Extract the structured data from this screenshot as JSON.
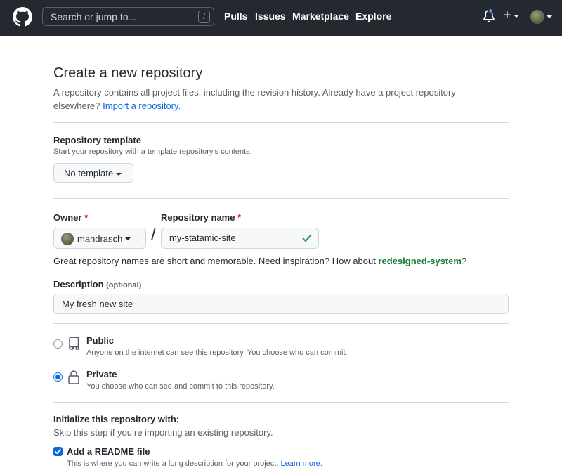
{
  "header": {
    "search_placeholder": "Search or jump to...",
    "search_shortcut": "/",
    "nav": [
      "Pulls",
      "Issues",
      "Marketplace",
      "Explore"
    ],
    "plus_label": "+"
  },
  "page": {
    "title": "Create a new repository",
    "subhead_text": "A repository contains all project files, including the revision history. Already have a project repository elsewhere?",
    "import_link": "Import a repository."
  },
  "template": {
    "label": "Repository template",
    "note": "Start your repository with a template repository's contents.",
    "button": "No template"
  },
  "owner": {
    "label": "Owner",
    "required_mark": "*",
    "value": "mandrasch"
  },
  "separator": "/",
  "repo_name": {
    "label": "Repository name",
    "required_mark": "*",
    "value": "my-statamic-site"
  },
  "inspiration": {
    "text": "Great repository names are short and memorable. Need inspiration? How about",
    "suggestion": "redesigned-system",
    "end": "?"
  },
  "description": {
    "label": "Description",
    "optional": "(optional)",
    "value": "My fresh new site"
  },
  "visibility": {
    "public": {
      "label": "Public",
      "note": "Anyone on the internet can see this repository. You choose who can commit.",
      "checked": false
    },
    "private": {
      "label": "Private",
      "note": "You choose who can see and commit to this repository.",
      "checked": true
    }
  },
  "init": {
    "title": "Initialize this repository with:",
    "note": "Skip this step if you’re importing an existing repository.",
    "readme": {
      "label": "Add a README file",
      "note": "This is where you can write a long description for your project.",
      "link": "Learn more.",
      "checked": true
    }
  },
  "colors": {
    "header_bg": "#24292f",
    "link": "#0969da",
    "success": "#2da44e",
    "suggestion": "#1a7f37",
    "required": "#cf222e"
  }
}
